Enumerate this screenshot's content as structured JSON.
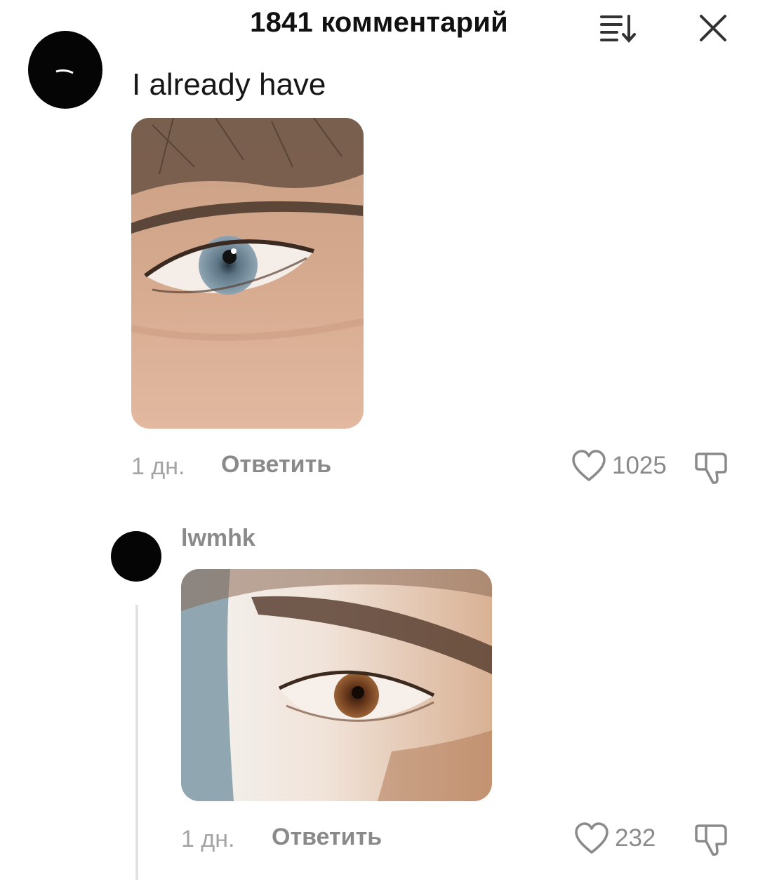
{
  "header": {
    "title": "1841 комментарий",
    "sort_icon": "sort-icon",
    "close_icon": "close-icon"
  },
  "comments": [
    {
      "text": "I already have",
      "image": "photo-eye-blue",
      "time": "1 дн.",
      "reply_label": "Ответить",
      "likes": "1025"
    },
    {
      "username": "lwmhk",
      "image": "photo-eye-brown",
      "time": "1 дн.",
      "reply_label": "Ответить",
      "likes": "232"
    }
  ],
  "colors": {
    "text_primary": "#161616",
    "text_secondary": "#8a8a8a",
    "avatar": "#050505",
    "thread_line": "#e2e2e2"
  }
}
